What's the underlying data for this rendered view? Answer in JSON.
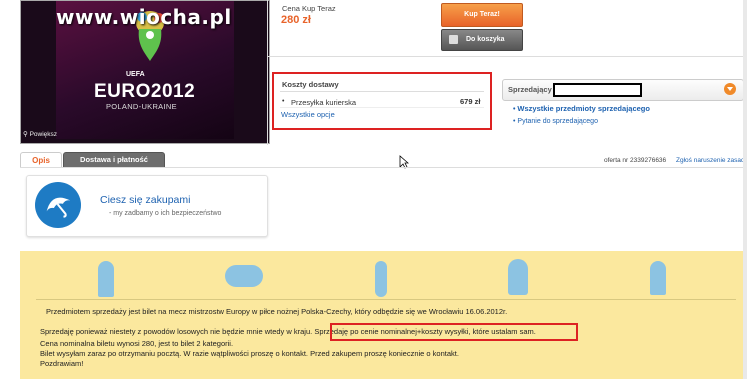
{
  "watermark": "www.wiocha.pl",
  "product_image": {
    "uefa_text": "UEFA",
    "euro_text": "EURO2012",
    "host_text": "POLAND-UKRAINE",
    "zoom_label": "Powiększ"
  },
  "price": {
    "label": "Cena Kup Teraz",
    "value": "280 zł",
    "buy_now_button": "Kup Teraz!",
    "cart_button": "Do koszyka"
  },
  "shipping": {
    "title": "Koszty dostawy",
    "method": "Przesyłka kurierska",
    "method_price": "679 zł",
    "all_options_link": "Wszystkie opcje"
  },
  "seller": {
    "label": "Sprzedający",
    "all_items_link": "Wszystkie przedmioty sprzedającego",
    "ask_link": "Pytanie do sprzedającego"
  },
  "tabs": [
    {
      "label": "Opis",
      "active": true
    },
    {
      "label": "Dostawa i płatność",
      "active": false
    }
  ],
  "offer": {
    "number_text": "oferta nr 2339276636",
    "report_link": "Zgłoś naruszenie zasad"
  },
  "enjoy": {
    "title": "Ciesz się zakupami",
    "subtitle": "my zadbamy o ich bezpieczeństwo"
  },
  "description": {
    "line1": "Przedmiotem sprzedaży jest bilet na mecz mistrzostw Europy w piłce nożnej Polska-Czechy, który odbędzie się we Wrocławiu 16.06.2012r.",
    "line2_a": "Sprzedaję ponieważ niestety z powodów losowych nie będzie mnie wtedy w kraju.",
    "line2_b": "Sprzedaję po cenie nominalnej+koszty wysyłki, które ustalam sam.",
    "line3": "Cena nominalna biletu wynosi 280, jest to bilet 2 kategorii.",
    "line4": "Bilet wysyłam zaraz po otrzymaniu pocztą. W razie wątpliwości proszę o kontakt. Przed zakupem proszę koniecznie o kontakt.",
    "line5": "Pozdrawiam!"
  },
  "colors": {
    "accent_orange": "#e8632a",
    "link_blue": "#1e62b0",
    "highlight_red": "#d22",
    "description_bg": "#fbe89e"
  }
}
